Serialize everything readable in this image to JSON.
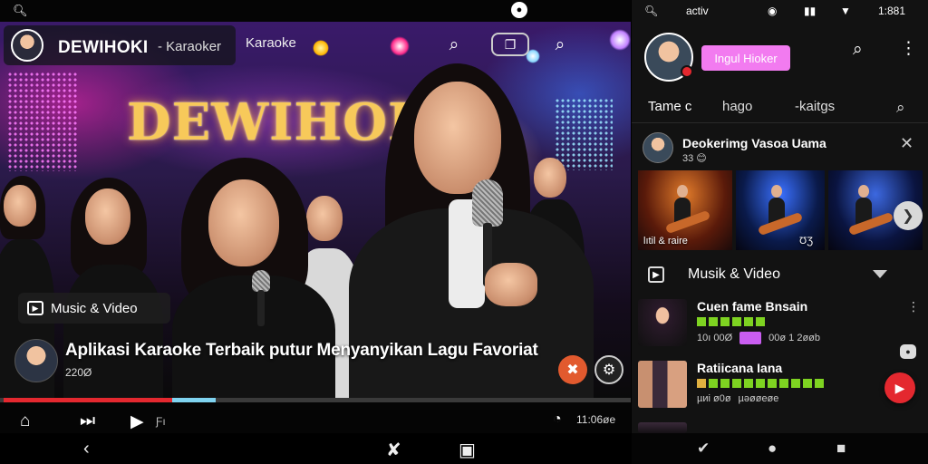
{
  "left": {
    "status_bar": {
      "search_icon": "search-icon",
      "center_icon": "notification-icon"
    },
    "header": {
      "brand": "DEWIHOKI",
      "dash_label": "- Karaoker",
      "link_label": "Karaoke",
      "icons": [
        "pin-icon",
        "cast-icon",
        "search-icon"
      ]
    },
    "hero": {
      "sign_text": "DEWIHOKI"
    },
    "category_chip": "Music & Video",
    "video": {
      "title": "Aplikasi Karaoke Terbaik putur Menyanyikan Lagu Favoriat",
      "subtitle": "220Ø"
    },
    "progress": {
      "played": 0.27,
      "buffered": 0.07,
      "loaded": 0.34
    },
    "controls": {
      "time": "11:06øe"
    },
    "controls_label_3": "Ƒı",
    "colors": {
      "accent": "#e4282f",
      "buffer": "#7fd3f0",
      "sign": "#f7c95a"
    }
  },
  "right": {
    "status_bar": {
      "search_icon": "search-icon",
      "carrier": "activ",
      "battery": "1:881"
    },
    "profile": {
      "pill_label": "Ingul Hioker"
    },
    "tabs": [
      "Tame c",
      "hago",
      "-kaitgs"
    ],
    "suggestion": {
      "title": "Deokerimg Vasoa Uama",
      "subtitle": "33 😊",
      "thumb_labels": [
        "lıtil & raire",
        "ƱƷ"
      ]
    },
    "section": {
      "title": "Musik & Video"
    },
    "list": [
      {
        "title": "Cuen fame Bnsain",
        "bars": 6,
        "meta_left": "10ı 00Ø",
        "meta_right": "00ø 1 2øøb",
        "badge": true
      },
      {
        "title": "Ratiicana Iana",
        "bars": 11,
        "meta_left": "µиi ø0ø",
        "meta_right": "µəøøeøe",
        "badge": false
      }
    ],
    "colors": {
      "pill": "#f27bf0",
      "fab": "#e4282f",
      "bars": "#7ed321"
    }
  }
}
